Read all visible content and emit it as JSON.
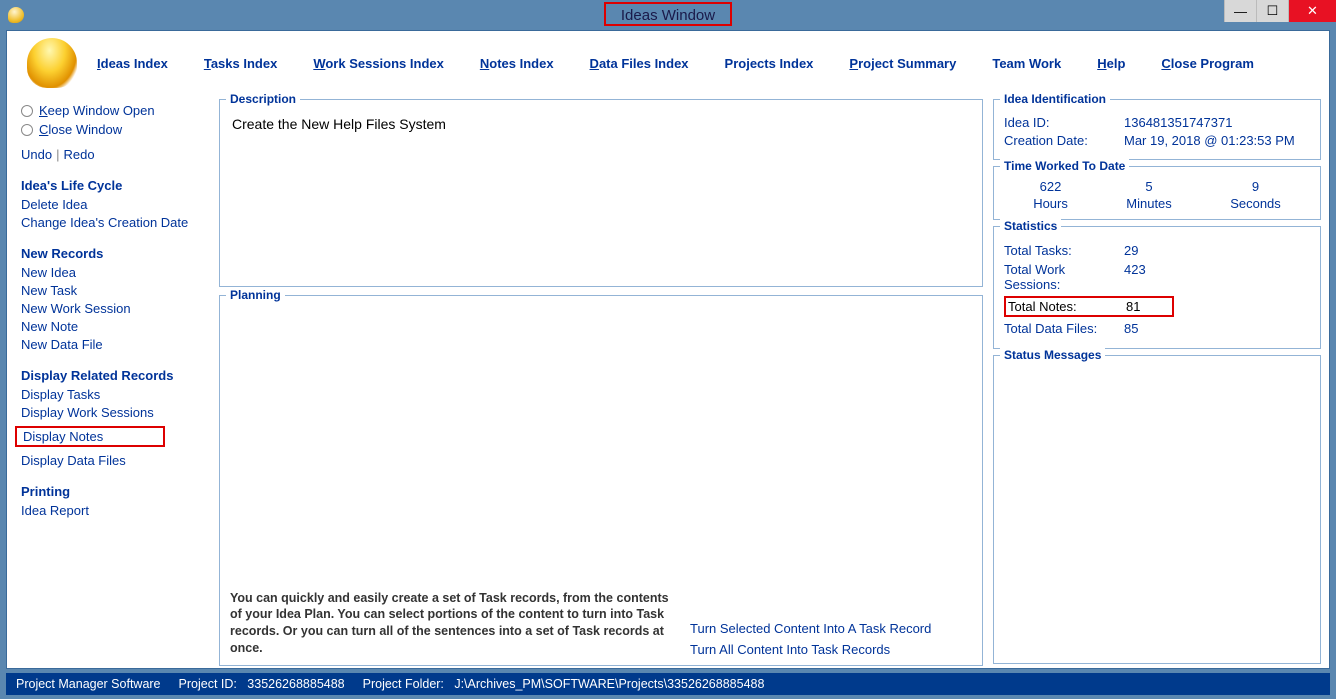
{
  "window": {
    "title": "Ideas Window"
  },
  "menu": {
    "ideas_index": "Ideas Index",
    "tasks_index": "Tasks Index",
    "work_sessions_index": "Work Sessions Index",
    "notes_index": "Notes Index",
    "data_files_index": "Data Files Index",
    "projects_index": "Projects Index",
    "project_summary": "Project Summary",
    "team_work": "Team Work",
    "help": "Help",
    "close_program": "Close Program"
  },
  "sidebar": {
    "keep_open": "Keep Window Open",
    "close_window": "Close Window",
    "undo": "Undo",
    "redo": "Redo",
    "life_cycle_head": "Idea's Life Cycle",
    "delete_idea": "Delete Idea",
    "change_date": "Change Idea's Creation Date",
    "new_records_head": "New Records",
    "new_idea": "New Idea",
    "new_task": "New Task",
    "new_work_session": "New Work Session",
    "new_note": "New Note",
    "new_data_file": "New Data File",
    "display_head": "Display Related Records",
    "display_tasks": "Display Tasks",
    "display_ws": "Display Work Sessions",
    "display_notes": "Display Notes",
    "display_df": "Display Data Files",
    "printing_head": "Printing",
    "idea_report": "Idea Report"
  },
  "main": {
    "description_label": "Description",
    "description_text": "Create the New Help Files System",
    "planning_label": "Planning",
    "planning_hint": "You can quickly and easily create a set of Task records, from the contents of your Idea Plan. You can select portions of the content to turn into Task records. Or you can turn all of the sentences into a set of Task records at once.",
    "turn_selected": "Turn Selected Content Into A Task Record",
    "turn_all": "Turn All Content Into Task Records"
  },
  "right": {
    "ident_label": "Idea Identification",
    "idea_id_label": "Idea ID:",
    "idea_id": "136481351747371",
    "creation_label": "Creation Date:",
    "creation_date": "Mar  19, 2018 @ 01:23:53 PM",
    "time_worked_label": "Time Worked To Date",
    "hours_val": "622",
    "hours_lbl": "Hours",
    "minutes_val": "5",
    "minutes_lbl": "Minutes",
    "seconds_val": "9",
    "seconds_lbl": "Seconds",
    "stats_label": "Statistics",
    "total_tasks_lbl": "Total Tasks:",
    "total_tasks": "29",
    "total_ws_lbl": "Total Work Sessions:",
    "total_ws": "423",
    "total_notes_lbl": "Total Notes:",
    "total_notes": "81",
    "total_df_lbl": "Total Data Files:",
    "total_df": "85",
    "status_label": "Status Messages"
  },
  "footer": {
    "app": "Project Manager Software",
    "proj_id_lbl": "Project ID:",
    "proj_id": "33526268885488",
    "proj_folder_lbl": "Project Folder:",
    "proj_folder": "J:\\Archives_PM\\SOFTWARE\\Projects\\33526268885488"
  }
}
